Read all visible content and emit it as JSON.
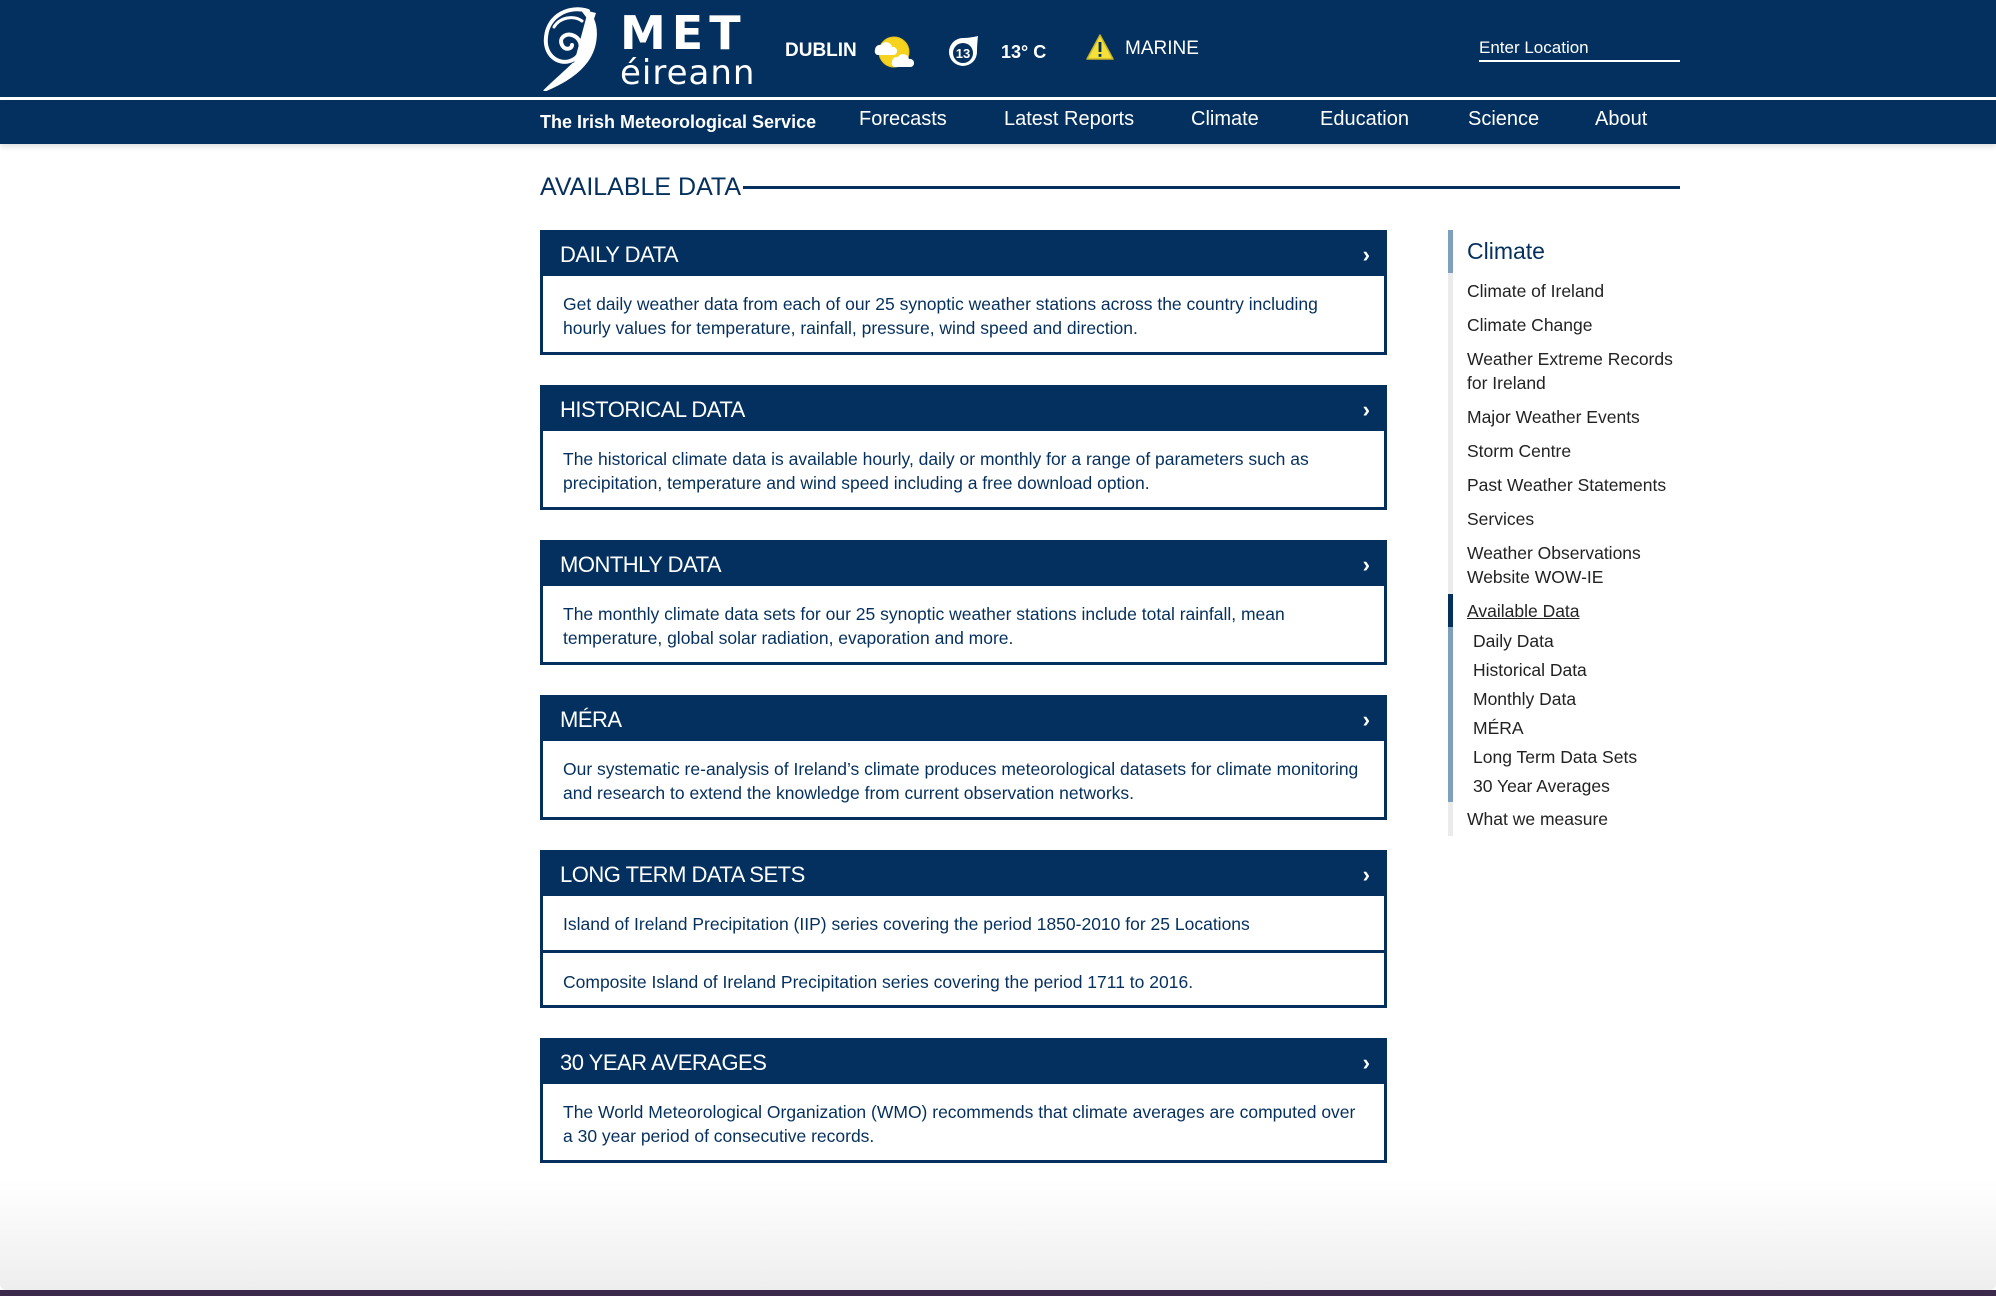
{
  "header": {
    "logo_top": "MET",
    "logo_bottom": "éireann",
    "weather": {
      "city": "DUBLIN",
      "condition_icon": "partly-cloudy-icon",
      "wind_icon": "wind-speed-icon",
      "wind_value": "13",
      "temperature": "13° C",
      "warning_icon": "warning-triangle-icon",
      "warning_label": "MARINE"
    },
    "location_input": {
      "placeholder": "Enter Location",
      "value": ""
    },
    "tagline": "The Irish Meteorological Service",
    "nav": [
      "Forecasts",
      "Latest Reports",
      "Climate",
      "Education",
      "Science",
      "About"
    ]
  },
  "colors": {
    "brand_navy": "#03305e",
    "text_navy": "#05305d",
    "sidebar_accent": "#7f9fbf",
    "warning_yellow": "#f5e03a"
  },
  "main": {
    "title": "AVAILABLE DATA",
    "cards": [
      {
        "title": "DAILY DATA",
        "body": [
          "Get daily weather data from each of our 25 synoptic weather stations across the country including hourly values for temperature, rainfall, pressure, wind speed and direction."
        ]
      },
      {
        "title": "HISTORICAL DATA",
        "body": [
          "The historical climate data is available hourly, daily or monthly for a range of parameters such as precipitation, temperature and wind speed including a free download option."
        ]
      },
      {
        "title": "MONTHLY DATA",
        "body": [
          "The monthly climate data sets for our 25 synoptic weather stations include total rainfall, mean temperature, global solar radiation, evaporation and more."
        ]
      },
      {
        "title": "MÉRA",
        "body": [
          "Our systematic re-analysis of Ireland’s climate produces meteorological datasets for climate monitoring and research to extend the knowledge from current observation networks."
        ]
      },
      {
        "title": "LONG TERM DATA SETS",
        "rows": [
          "Island of Ireland Precipitation (IIP) series covering the period 1850-2010 for 25 Locations",
          "Composite Island of Ireland Precipitation series covering the period 1711 to 2016."
        ]
      },
      {
        "title": "30 YEAR AVERAGES",
        "body": [
          "The World Meteorological Organization (WMO) recommends that climate averages are computed over a 30 year period of consecutive records."
        ]
      }
    ],
    "chevron": "›"
  },
  "sidebar": {
    "heading": "Climate",
    "items": [
      "Climate of Ireland",
      "Climate Change",
      "Weather Extreme Records for Ireland",
      "Major Weather Events",
      "Storm Centre",
      "Past Weather Statements",
      "Services",
      "Weather Observations Website WOW-IE",
      "Available Data",
      "What we measure"
    ],
    "active_item": "Available Data",
    "sub_items": [
      "Daily Data",
      "Historical Data",
      "Monthly Data",
      "MÉRA",
      "Long Term Data Sets",
      "30 Year Averages"
    ]
  }
}
